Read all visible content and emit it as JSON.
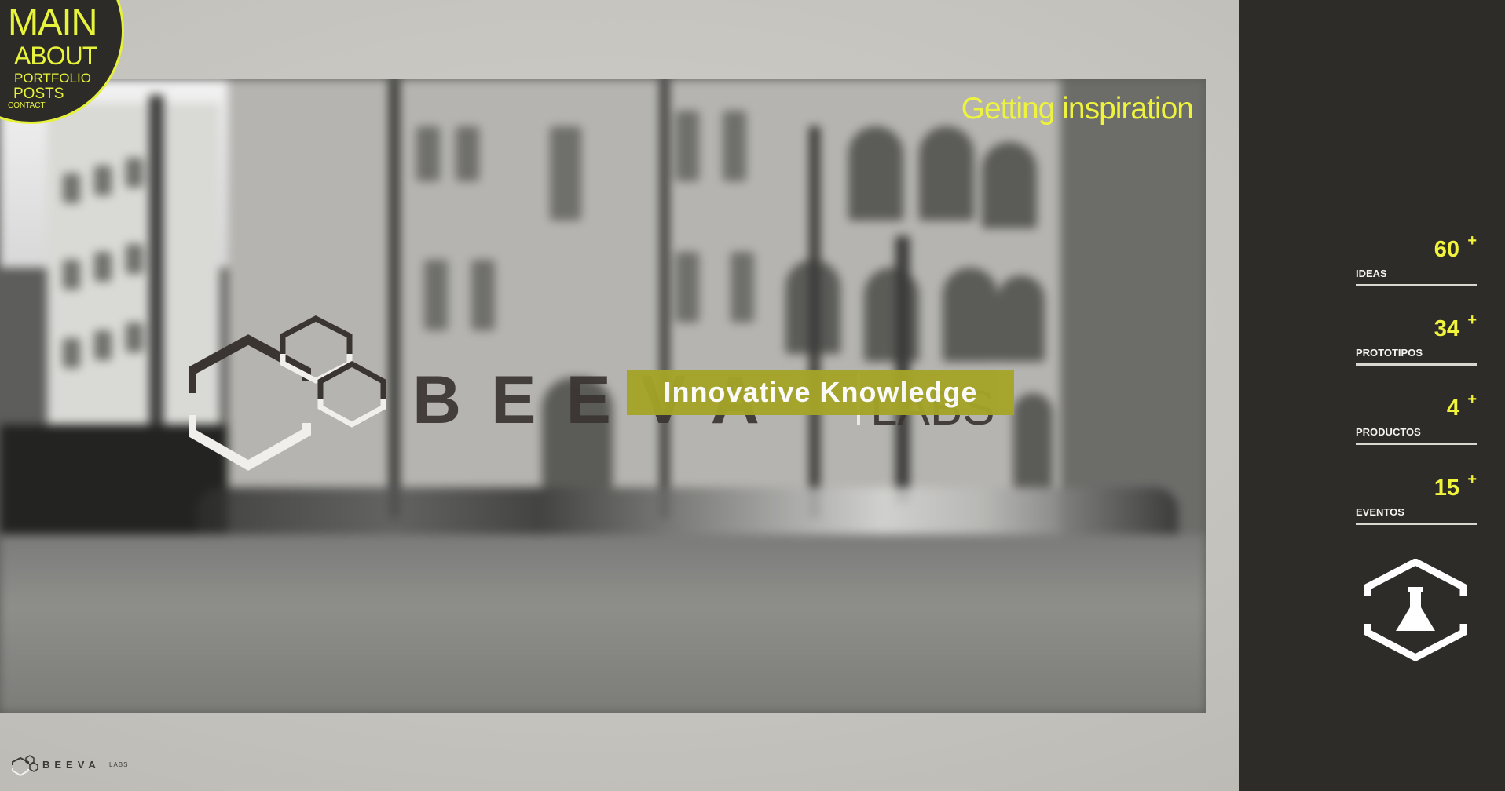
{
  "nav": {
    "main": "MAIN",
    "about": "ABOUT",
    "portfolio": "PORTFOLIO",
    "posts": "POSTS",
    "contact": "CONTACT"
  },
  "hero": {
    "title": "Getting inspiration",
    "logo_text": "BEEVA",
    "logo_labs": "LABS",
    "tagline": "Innovative Knowledge"
  },
  "stats": [
    {
      "value": "60",
      "plus": "+",
      "label": "IDEAS"
    },
    {
      "value": "34",
      "plus": "+",
      "label": "PROTOTIPOS"
    },
    {
      "value": "4",
      "plus": "+",
      "label": "PRODUCTOS"
    },
    {
      "value": "15",
      "plus": "+",
      "label": "EVENTOS"
    }
  ],
  "footer": {
    "logo_text": "BEEVA",
    "logo_labs": "LABS"
  },
  "colors": {
    "accent": "#e8f33c",
    "panel": "#2d2c29",
    "tagline_bg": "#a5a528"
  }
}
